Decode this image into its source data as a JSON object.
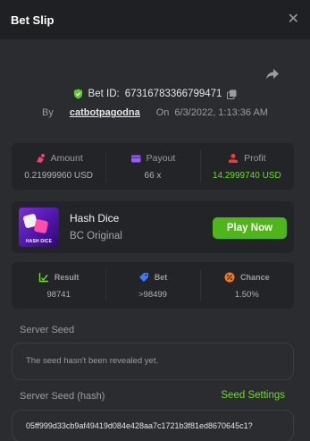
{
  "header": {
    "title": "Bet Slip",
    "close_icon": "close-icon"
  },
  "bet": {
    "id_label": "Bet ID:",
    "id_value": "67316783366799471",
    "by_label": "By",
    "username": "catbotpagodna",
    "on_label": "On",
    "datetime": "6/3/2022, 1:13:36 AM"
  },
  "stats": {
    "amount": {
      "label": "Amount",
      "value": "0.21999960 USD",
      "icon": "coin-bag-icon",
      "color": "#f0436e"
    },
    "payout": {
      "label": "Payout",
      "value": "66 x",
      "icon": "wallet-icon",
      "color": "#9b5cff"
    },
    "profit": {
      "label": "Profit",
      "value": "14.2999740 USD",
      "icon": "hand-coin-icon",
      "color": "#ef3b3b"
    }
  },
  "game": {
    "thumb_label": "HASH DICE",
    "name": "Hash Dice",
    "provider": "BC Original",
    "play_label": "Play Now"
  },
  "results": {
    "result": {
      "label": "Result",
      "value": "98741",
      "icon": "check-chart-icon",
      "color": "#6fdc2a"
    },
    "bet": {
      "label": "Bet",
      "value": ">98499",
      "icon": "tag-icon",
      "color": "#3a7bff"
    },
    "chance": {
      "label": "Chance",
      "value": "1.50%",
      "icon": "percent-icon",
      "color": "#f27a1a"
    }
  },
  "seeds": {
    "server_seed_label": "Server Seed",
    "server_seed_text": "The seed hasn't been revealed yet.",
    "hash_label": "Server Seed (hash)",
    "settings_label": "Seed Settings",
    "hash_value": "05ff999d33cb9af49419d084e428aa7c1721b3f81ed8670645c1?"
  },
  "colors": {
    "accent_green": "#6fdc2a",
    "play_button": "#4fb51b"
  }
}
